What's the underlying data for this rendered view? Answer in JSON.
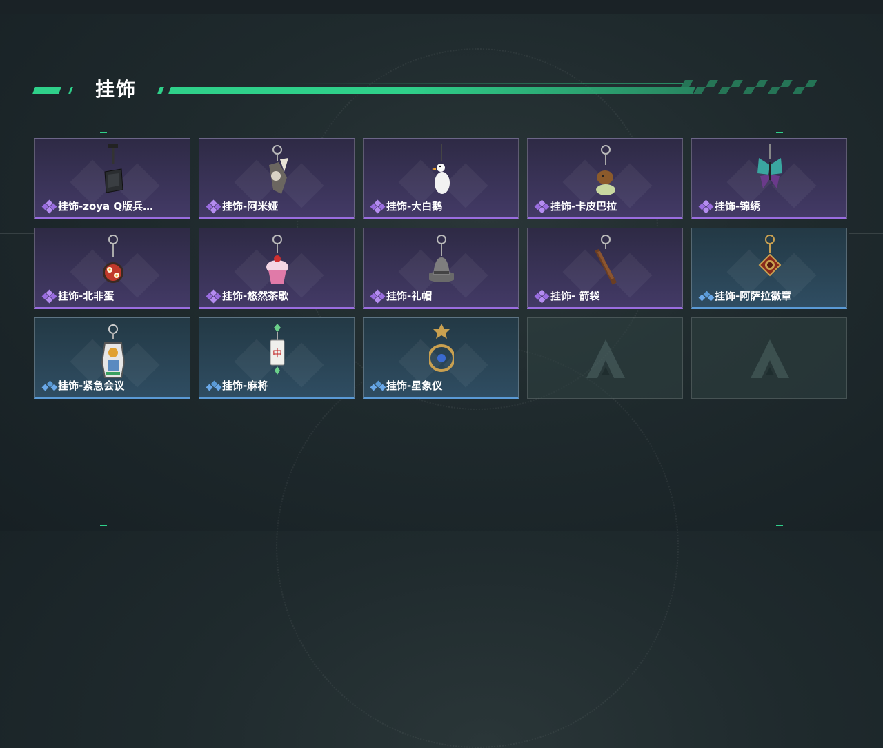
{
  "header": {
    "title": "挂饰"
  },
  "colors": {
    "accent": "#2fd08a",
    "epic": "#9a6de0",
    "rare": "#5a9ad6"
  },
  "items": [
    {
      "label": "挂饰-zoya Q版兵…",
      "rarity": "epic",
      "icon": "black-bag-charm-icon"
    },
    {
      "label": "挂饰-阿米娅",
      "rarity": "epic",
      "icon": "rabbit-figure-charm-icon"
    },
    {
      "label": "挂饰-大白鹅",
      "rarity": "epic",
      "icon": "white-goose-charm-icon"
    },
    {
      "label": "挂饰-卡皮巴拉",
      "rarity": "epic",
      "icon": "capybara-charm-icon"
    },
    {
      "label": "挂饰-锦绣",
      "rarity": "epic",
      "icon": "butterfly-charm-icon"
    },
    {
      "label": "挂饰-北非蛋",
      "rarity": "epic",
      "icon": "shakshuka-pan-charm-icon"
    },
    {
      "label": "挂饰-悠然茶歇",
      "rarity": "epic",
      "icon": "cupcake-charm-icon"
    },
    {
      "label": "挂饰-礼帽",
      "rarity": "epic",
      "icon": "fedora-hat-charm-icon"
    },
    {
      "label": "挂饰- 箭袋",
      "rarity": "epic",
      "icon": "quiver-charm-icon"
    },
    {
      "label": "挂饰-阿萨拉徽章",
      "rarity": "rare",
      "icon": "badge-medal-charm-icon"
    },
    {
      "label": "挂饰-紧急会议",
      "rarity": "rare",
      "icon": "figure-emblem-charm-icon"
    },
    {
      "label": "挂饰-麻将",
      "rarity": "rare",
      "icon": "mahjong-tile-charm-icon"
    },
    {
      "label": "挂饰-星象仪",
      "rarity": "rare",
      "icon": "astrolabe-charm-icon"
    },
    {
      "label": "",
      "rarity": "empty",
      "icon": "empty-slot-logo-icon"
    },
    {
      "label": "",
      "rarity": "empty",
      "icon": "empty-slot-logo-icon"
    }
  ]
}
